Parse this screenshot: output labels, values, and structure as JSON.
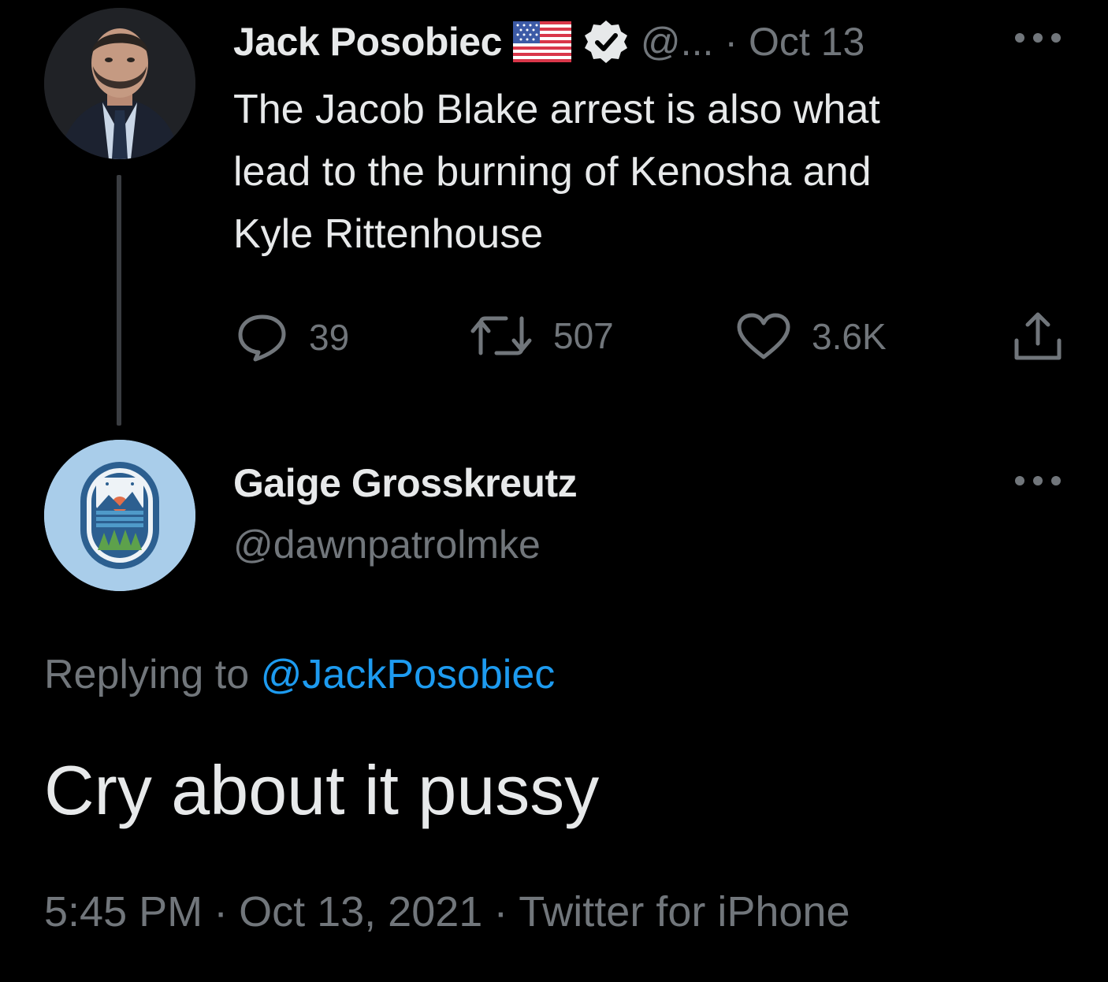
{
  "parent_tweet": {
    "author_name": "Jack Posobiec",
    "author_handle": "@...",
    "separator": "·",
    "date": "Oct 13",
    "text_lines": [
      "The Jacob Blake arrest is also what",
      "lead to the burning of Kenosha and",
      "Kyle Rittenhouse"
    ],
    "replies_count": "39",
    "retweets_count": "507",
    "likes_count": "3.6K"
  },
  "reply_tweet": {
    "author_name": "Gaige Grosskreutz",
    "author_handle": "@dawnpatrolmke",
    "replying_prefix": "Replying to",
    "replying_to": "@JackPosobiec",
    "text": "Cry about it pussy",
    "time": "5:45 PM",
    "separator": "·",
    "date": "Oct 13, 2021",
    "source": "Twitter for iPhone"
  },
  "icons": {
    "flag": "us-flag-icon",
    "verified": "verified-badge-icon",
    "more": "more-options-icon",
    "reply": "reply-icon",
    "retweet": "retweet-icon",
    "like": "heart-icon",
    "share": "share-icon"
  },
  "colors": {
    "background": "#000000",
    "text": "#e7e9ea",
    "muted": "#71767b",
    "link": "#1d9bf0"
  }
}
